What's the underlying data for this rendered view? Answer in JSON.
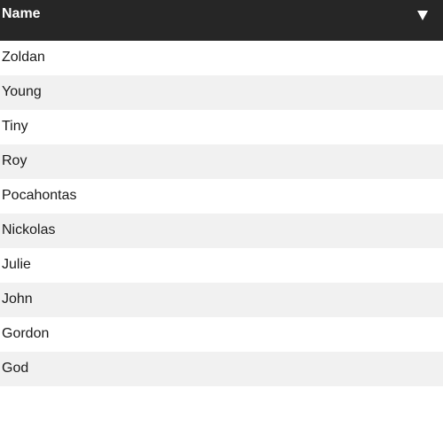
{
  "column": {
    "label": "Name",
    "sort_icon": "triangle-down-icon"
  },
  "rows": [
    "Zoldan",
    "Young",
    "Tiny",
    "Roy",
    "Pocahontas",
    "Nickolas",
    "Julie",
    "John",
    "Gordon",
    "God"
  ],
  "colors": {
    "header_bg": "#262626",
    "header_text": "#ffffff",
    "row_alt_bg": "#f1f1f1",
    "row_bg": "#ffffff"
  }
}
